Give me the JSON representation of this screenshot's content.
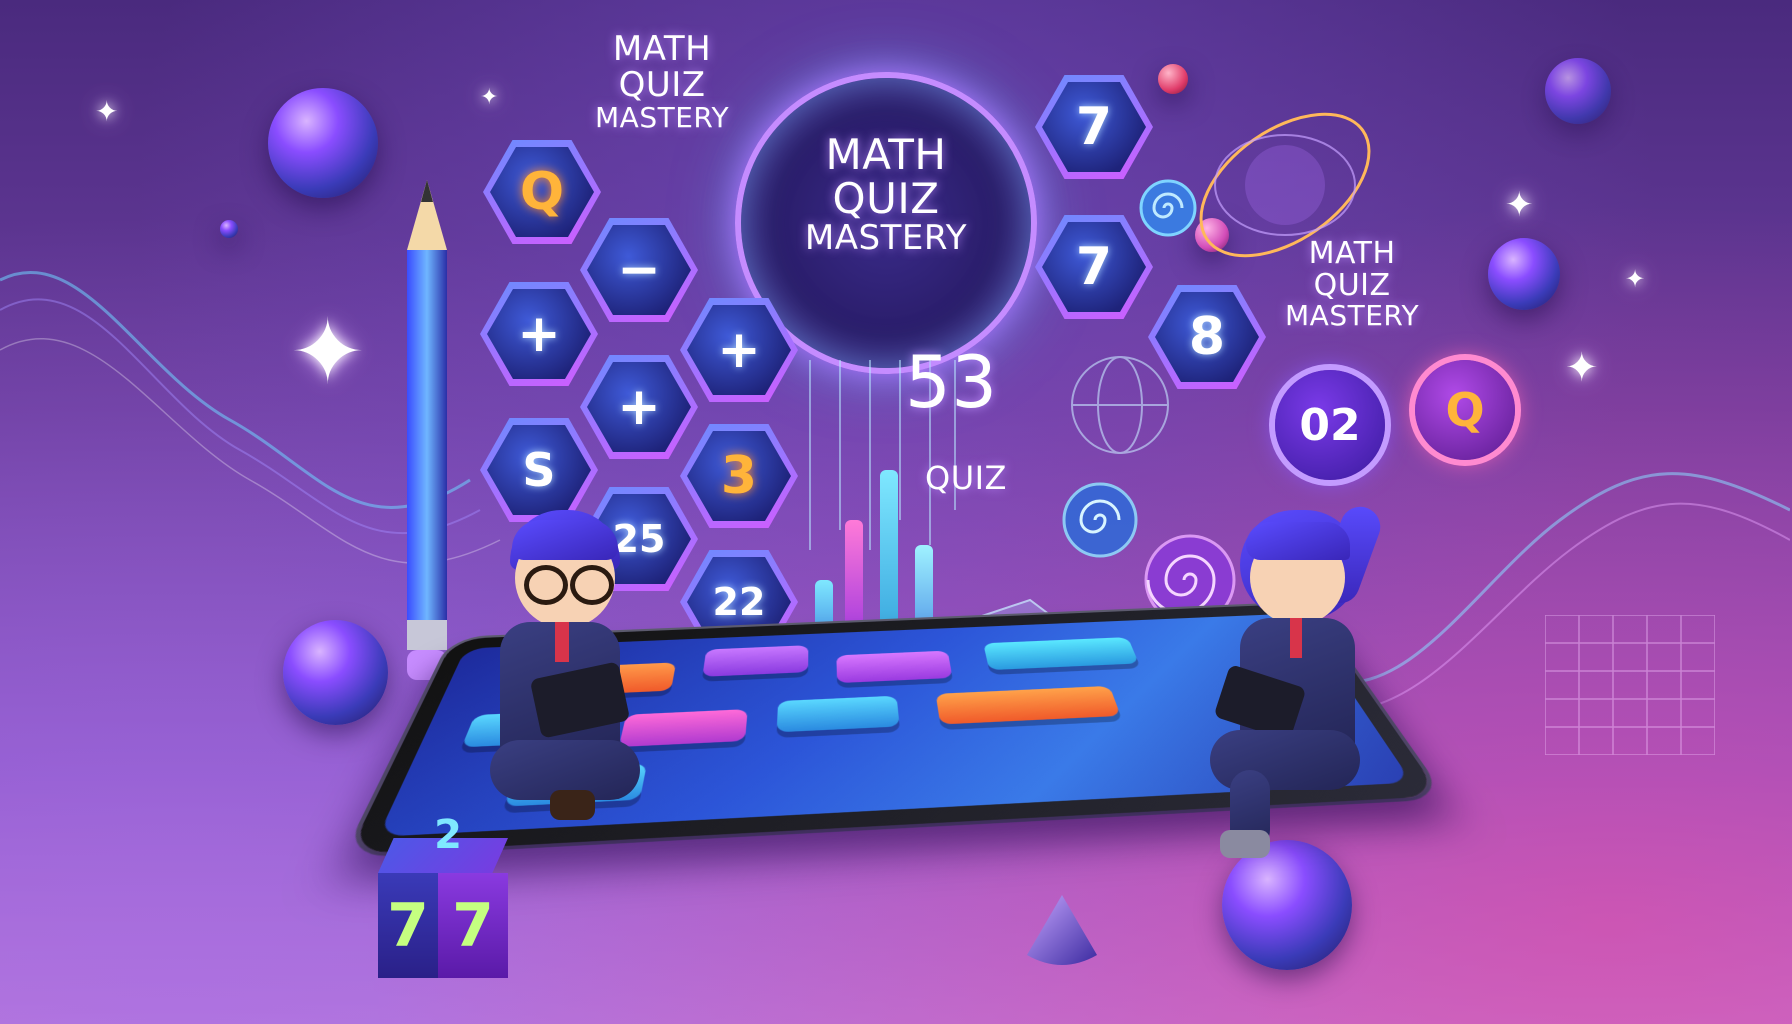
{
  "texts": {
    "top_left_title": [
      "MATH",
      "QUIZ",
      "MASTERY"
    ],
    "ring_title": [
      "MATH",
      "QUIZ",
      "MASTERY"
    ],
    "right_title": [
      "MATH",
      "QUIZ",
      "MASTERY"
    ],
    "center_number": "53",
    "center_quiz": "QUIZ"
  },
  "hex_tiles": [
    "Q",
    "−",
    "+",
    "+",
    "+",
    "S",
    "3",
    "25",
    "22"
  ],
  "right_hexes": [
    "7",
    "7",
    "8"
  ],
  "badges": [
    "02",
    "Q"
  ],
  "dice": {
    "top": "2",
    "front": "7",
    "side": "7"
  },
  "colors": {
    "background_top": "#4a2a7e",
    "background_bottom": "#b77ad8",
    "accent_gold": "#ffb43a",
    "accent_cyan": "#5ad8ff",
    "accent_magenta": "#d25cff"
  },
  "icons": [
    "sparkle-icon",
    "pencil-icon",
    "sphere-icon",
    "bar-chart-icon",
    "swirl-icon"
  ]
}
